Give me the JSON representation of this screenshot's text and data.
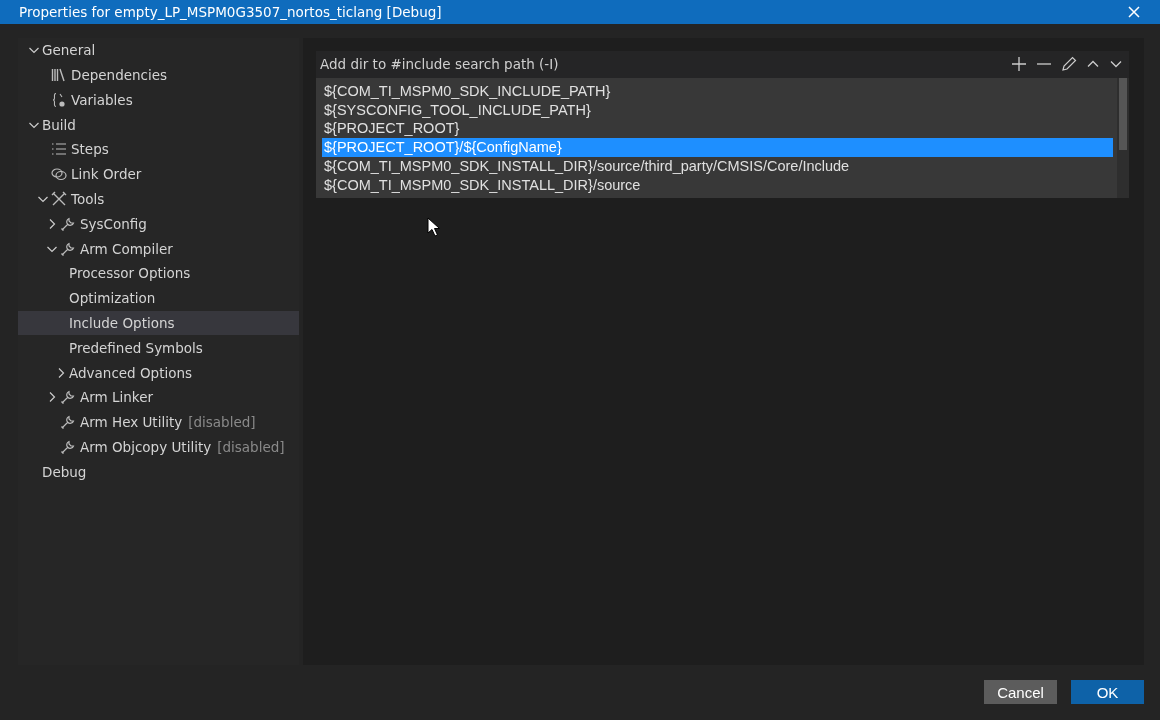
{
  "window": {
    "title": "Properties for empty_LP_MSPM0G3507_nortos_ticlang [Debug]"
  },
  "tree": [
    {
      "label": "General",
      "expanded": true,
      "selected": false,
      "children": [
        {
          "label": "Dependencies",
          "kind": "dependencies",
          "selected": false
        },
        {
          "label": "Variables",
          "kind": "variables",
          "selected": false
        }
      ]
    },
    {
      "label": "Build",
      "expanded": true,
      "selected": false,
      "children": [
        {
          "label": "Steps",
          "kind": "steps",
          "selected": false
        },
        {
          "label": "Link Order",
          "kind": "link-order",
          "selected": false
        },
        {
          "label": "Tools",
          "kind": "tools",
          "expanded": true,
          "selected": false,
          "children": [
            {
              "label": "SysConfig",
              "kind": "tool",
              "expanded": false,
              "selected": false
            },
            {
              "label": "Arm Compiler",
              "kind": "tool",
              "expanded": true,
              "selected": false,
              "children": [
                {
                  "label": "Processor Options",
                  "selected": false
                },
                {
                  "label": "Optimization",
                  "selected": false
                },
                {
                  "label": "Include Options",
                  "selected": true
                },
                {
                  "label": "Predefined Symbols",
                  "selected": false
                },
                {
                  "label": "Advanced Options",
                  "expanded": false,
                  "selected": false
                }
              ]
            },
            {
              "label": "Arm Linker",
              "kind": "tool",
              "expanded": false,
              "selected": false
            },
            {
              "label": "Arm Hex Utility",
              "kind": "tool",
              "suffix": "[disabled]",
              "selected": false
            },
            {
              "label": "Arm Objcopy Utility",
              "kind": "tool",
              "suffix": "[disabled]",
              "selected": false
            }
          ]
        }
      ]
    },
    {
      "label": "Debug",
      "selected": false
    }
  ],
  "include_paths": {
    "title": "Add dir to #include search path (-I)",
    "items": [
      {
        "text": "${COM_TI_MSPM0_SDK_INCLUDE_PATH}",
        "selected": false
      },
      {
        "text": "${SYSCONFIG_TOOL_INCLUDE_PATH}",
        "selected": false
      },
      {
        "text": "${PROJECT_ROOT}",
        "selected": false
      },
      {
        "text": "${PROJECT_ROOT}/${ConfigName}",
        "selected": true
      },
      {
        "text": "${COM_TI_MSPM0_SDK_INSTALL_DIR}/source/third_party/CMSIS/Core/Include",
        "selected": false
      },
      {
        "text": "${COM_TI_MSPM0_SDK_INSTALL_DIR}/source",
        "selected": false
      }
    ]
  },
  "buttons": [
    {
      "label": "Cancel",
      "kind": "secondary"
    },
    {
      "label": "OK",
      "kind": "primary"
    }
  ]
}
